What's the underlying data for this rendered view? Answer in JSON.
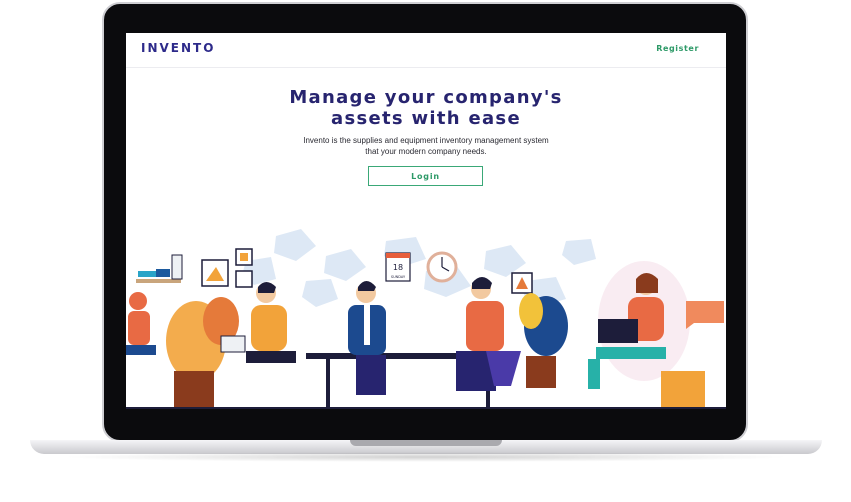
{
  "nav": {
    "brand": "INVENTO",
    "register_label": "Register"
  },
  "hero": {
    "title_line1": "Manage your company's",
    "title_line2": "assets with ease",
    "subtitle_line1": "Invento is the supplies and equipment inventory management system",
    "subtitle_line2": "that your modern company needs.",
    "login_label": "Login"
  },
  "illustration": {
    "calendar_day": "18",
    "calendar_weekday": "SUNDAY"
  },
  "colors": {
    "brand": "#2d2a8a",
    "accent_green": "#2e9a68",
    "title": "#27246f"
  }
}
